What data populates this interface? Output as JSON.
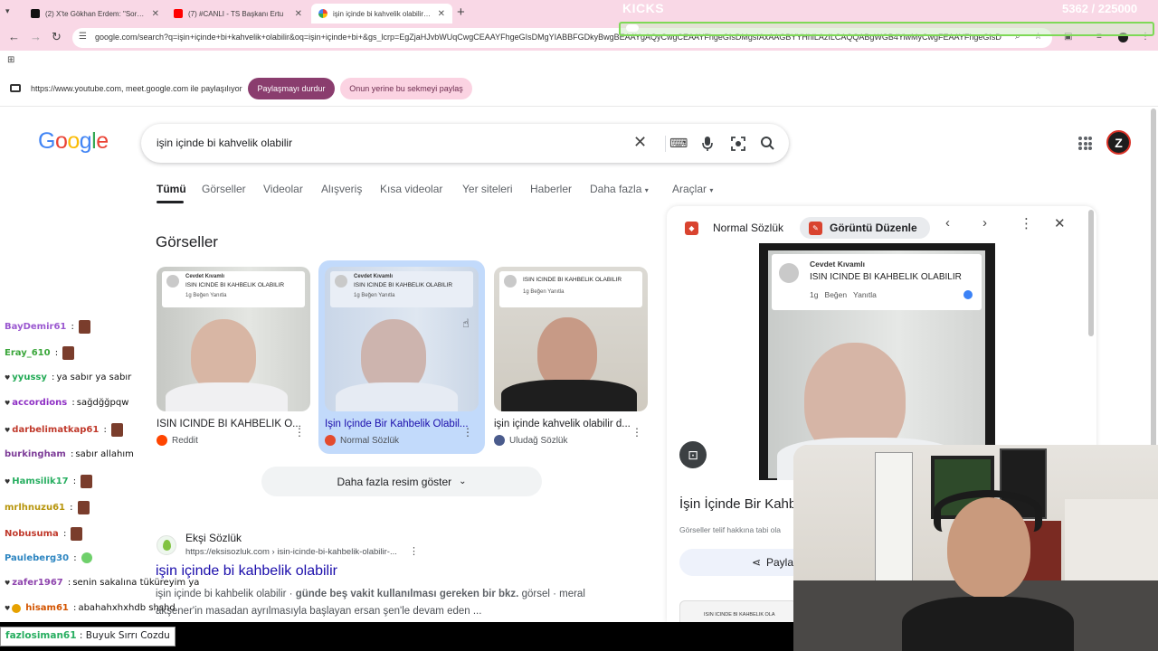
{
  "browser": {
    "tabs": [
      {
        "label": "(2) X'te Gökhan Erdem: \"Sorum",
        "icon": "x-logo-icon"
      },
      {
        "label": "(7) #CANLI - TS Başkanı Ertu",
        "icon": "youtube-icon"
      },
      {
        "label": "işin içinde bi kahvelik olabilir - G",
        "icon": "google-icon"
      }
    ],
    "url": "google.com/search?q=işin+içinde+bi+kahvelik+olabilir&oq=işin+içinde+bi+&gs_lcrp=EgZjaHJvbWUqCwgCEAAYFhgeGIsDMgYIABBFGDkyBwgBEAAYgAQyCwgCEAAYFhgeGIsDMgsIAxAAGBYYHhiLAzILCAQQABgWGB4YiwMyCwgFEAAYFhgeGIsD"
  },
  "overlay": {
    "kicks_label": "KICKS",
    "kicks_count": "5362 / 225000",
    "kicks_progress": 0.024
  },
  "sharing": {
    "text": "https://www.youtube.com, meet.google.com ile paylaşılıyor",
    "stop_label": "Paylaşmayı durdur",
    "share_tab_label": "Onun yerine bu sekmeyi paylaş"
  },
  "google": {
    "logo": [
      "G",
      "o",
      "o",
      "g",
      "l",
      "e"
    ],
    "logo_colors": [
      "#4285f4",
      "#ea4335",
      "#fbbc05",
      "#4285f4",
      "#34a853",
      "#ea4335"
    ],
    "query": "işin içinde bi kahvelik olabilir",
    "avatar_letter": "Z",
    "tabs": [
      "Tümü",
      "Görseller",
      "Videolar",
      "Alışveriş",
      "Kısa videolar",
      "Yer siteleri",
      "Haberler",
      "Daha fazla",
      "Araçlar"
    ],
    "images_section_title": "Görseller",
    "images": [
      {
        "caption": "ISIN ICINDE BI KAHBELIK O...",
        "source": "Reddit",
        "source_color": "#ff4500",
        "comment_name": "Cevdet Kıvamlı",
        "comment_text": "ISIN ICINDE BI KAHBELIK OLABILIR",
        "comment_meta": "1g   Beğen   Yanıtla"
      },
      {
        "caption": "İşin İçinde Bir Kahbelik Olabil...",
        "source": "Normal Sözlük",
        "source_color": "#e34b2f",
        "comment_name": "Cevdet Kıvamlı",
        "comment_text": "ISIN ICINDE BI KAHBELIK OLABILIR",
        "comment_meta": "1g   Beğen   Yanıtla"
      },
      {
        "caption": "işin içinde kahvelik olabilir d...",
        "source": "Uludağ Sözlük",
        "source_color": "#4a5b8c",
        "comment_name": "",
        "comment_text": "ISIN ICINDE BI KAHBELIK OLABILIR",
        "comment_meta": "1g   Beğen   Yanıtla"
      }
    ],
    "more_images_label": "Daha fazla resim göster",
    "result": {
      "site": "Ekşi Sözlük",
      "url": "https://eksisozluk.com › isin-icinde-bi-kahbelik-olabilir-...",
      "title": "işin içinde bi kahbelik olabilir",
      "snippet_plain_1": "işin içinde bi kahbelik olabilir · ",
      "snippet_bold": "günde beş vakit kullanılması gereken bir bkz.",
      "snippet_plain_2": " görsel · meral akşener'in masadan ayrılmasıyla başlayan ersan şen'le devam eden ..."
    }
  },
  "side_panel": {
    "site_tab": "Normal Sözlük",
    "edit_tab": "Görüntü Düzenle",
    "comment_name": "Cevdet Kıvamlı",
    "comment_text": "ISIN ICINDE BI KAHBELIK OLABILIR",
    "comment_meta": "1g   Beğen   Yanıtla",
    "title": "İşin İçinde Bir Kahb",
    "copyright": "Görseller telif hakkına tabi ola",
    "share_label": "Payla",
    "thumb_text": "ISIN ICINDE BI KAHBELIK OLA"
  },
  "chat": [
    {
      "user": "BayDemir61",
      "color": "#9b59d0",
      "text": "",
      "emote": "brown"
    },
    {
      "user": "Eray_610",
      "color": "#3aa63a",
      "text": "",
      "emote": "brown"
    },
    {
      "user": "yyussy",
      "color": "#22aa55",
      "text": "ya sabır ya sabır",
      "emote": ""
    },
    {
      "user": "accordions",
      "color": "#8e2fc4",
      "text": "sağdğğpqw",
      "emote": ""
    },
    {
      "user": "darbelimatkap61",
      "color": "#c0392b",
      "text": "",
      "emote": "brown"
    },
    {
      "user": "burkingham",
      "color": "#7d3c98",
      "text": "sabır allahım",
      "emote": ""
    },
    {
      "user": "Hamsilik17",
      "color": "#27ae60",
      "text": "",
      "emote": "brown"
    },
    {
      "user": "mrlhnuzu61",
      "color": "#b7950b",
      "text": "",
      "emote": "brown"
    },
    {
      "user": "Nobusuma",
      "color": "#c0392b",
      "text": "",
      "emote": "brown"
    },
    {
      "user": "Pauleberg30",
      "color": "#2e86c1",
      "text": "",
      "emote": "green"
    },
    {
      "user": "zafer1967",
      "color": "#8e44ad",
      "text": "senin sakalına tüküreyim ya",
      "emote": ""
    },
    {
      "user": "hisam61",
      "color": "#d35400",
      "text": "abahahxhxhdb shshd",
      "emote": ""
    }
  ],
  "last_chat": {
    "user": "fazlosiman61",
    "color": "#27ae60",
    "text": "Buyuk Sırrı Cozdu"
  }
}
